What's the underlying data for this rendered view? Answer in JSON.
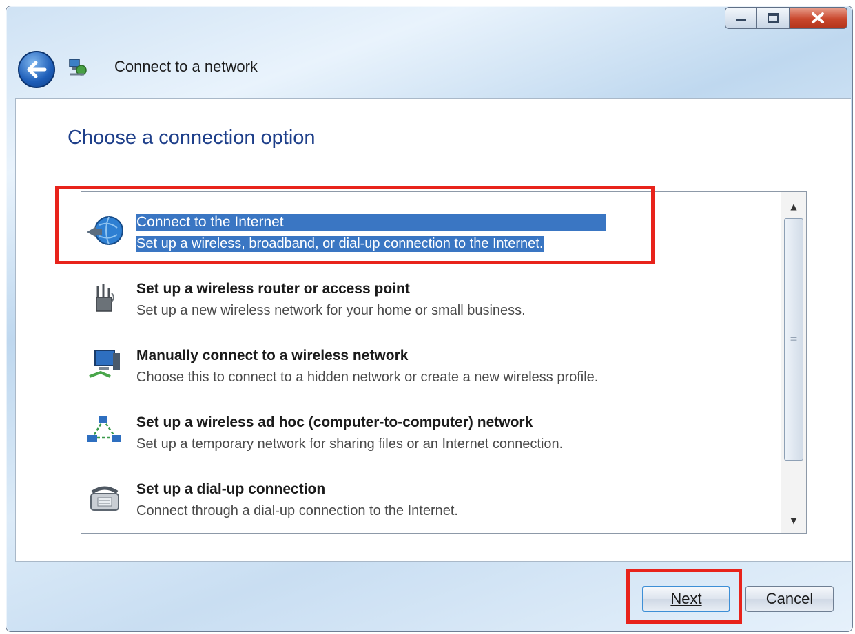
{
  "window": {
    "title": "Connect to a network",
    "caption_buttons": {
      "minimize_icon": "minimize-icon",
      "maximize_icon": "maximize-icon",
      "close_icon": "close-icon"
    }
  },
  "main": {
    "heading": "Choose a connection option",
    "options": [
      {
        "title": "Connect to the Internet",
        "description": "Set up a wireless, broadband, or dial-up connection to the Internet.",
        "icon": "globe-network-icon",
        "selected": true
      },
      {
        "title": "Set up a wireless router or access point",
        "description": "Set up a new wireless network for your home or small business.",
        "icon": "router-icon",
        "selected": false
      },
      {
        "title": "Manually connect to a wireless network",
        "description": "Choose this to connect to a hidden network or create a new wireless profile.",
        "icon": "computer-wireless-icon",
        "selected": false
      },
      {
        "title": "Set up a wireless ad hoc (computer-to-computer) network",
        "description": "Set up a temporary network for sharing files or an Internet connection.",
        "icon": "adhoc-network-icon",
        "selected": false
      },
      {
        "title": "Set up a dial-up connection",
        "description": "Connect through a dial-up connection to the Internet.",
        "icon": "phone-modem-icon",
        "selected": false
      }
    ]
  },
  "footer": {
    "next_label": "Next",
    "cancel_label": "Cancel"
  },
  "colors": {
    "selection": "#3a76c3",
    "heading": "#1e3f8a",
    "highlight": "#e8231b"
  }
}
